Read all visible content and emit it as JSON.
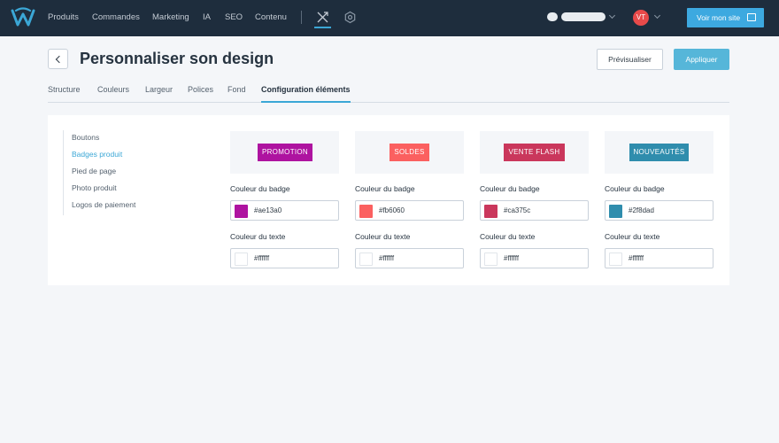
{
  "nav": {
    "items": [
      "Produits",
      "Commandes",
      "Marketing",
      "IA",
      "SEO",
      "Contenu"
    ],
    "design_icon": "design-tools-icon",
    "settings_icon": "gear-icon",
    "avatar_initials": "VT",
    "site_button_label": "Voir mon site",
    "accent_color": "#3da9e0"
  },
  "header": {
    "title": "Personnaliser son design",
    "preview_label": "Prévisualiser",
    "apply_label": "Appliquer"
  },
  "tabs": [
    {
      "label": "Structure"
    },
    {
      "label": "Couleurs"
    },
    {
      "label": "Largeur"
    },
    {
      "label": "Polices"
    },
    {
      "label": "Fond"
    },
    {
      "label": "Configuration éléments",
      "active": true
    }
  ],
  "side_menu": [
    {
      "label": "Boutons"
    },
    {
      "label": "Badges produit",
      "active": true
    },
    {
      "label": "Pied de page"
    },
    {
      "label": "Photo produit"
    },
    {
      "label": "Logos de paiement"
    }
  ],
  "badges": [
    {
      "text": "PROMOTION",
      "badge_label": "Couleur du badge",
      "badge_color": "#ae13a0",
      "text_label": "Couleur du texte",
      "text_color": "#ffffff"
    },
    {
      "text": "SOLDES",
      "badge_label": "Couleur du badge",
      "badge_color": "#fb6060",
      "text_label": "Couleur du texte",
      "text_color": "#ffffff"
    },
    {
      "text": "VENTE FLASH",
      "badge_label": "Couleur du badge",
      "badge_color": "#ca375c",
      "text_label": "Couleur du texte",
      "text_color": "#ffffff"
    },
    {
      "text": "NOUVEAUTÉS",
      "badge_label": "Couleur du badge",
      "badge_color": "#2f8dad",
      "text_label": "Couleur du texte",
      "text_color": "#ffffff"
    }
  ]
}
